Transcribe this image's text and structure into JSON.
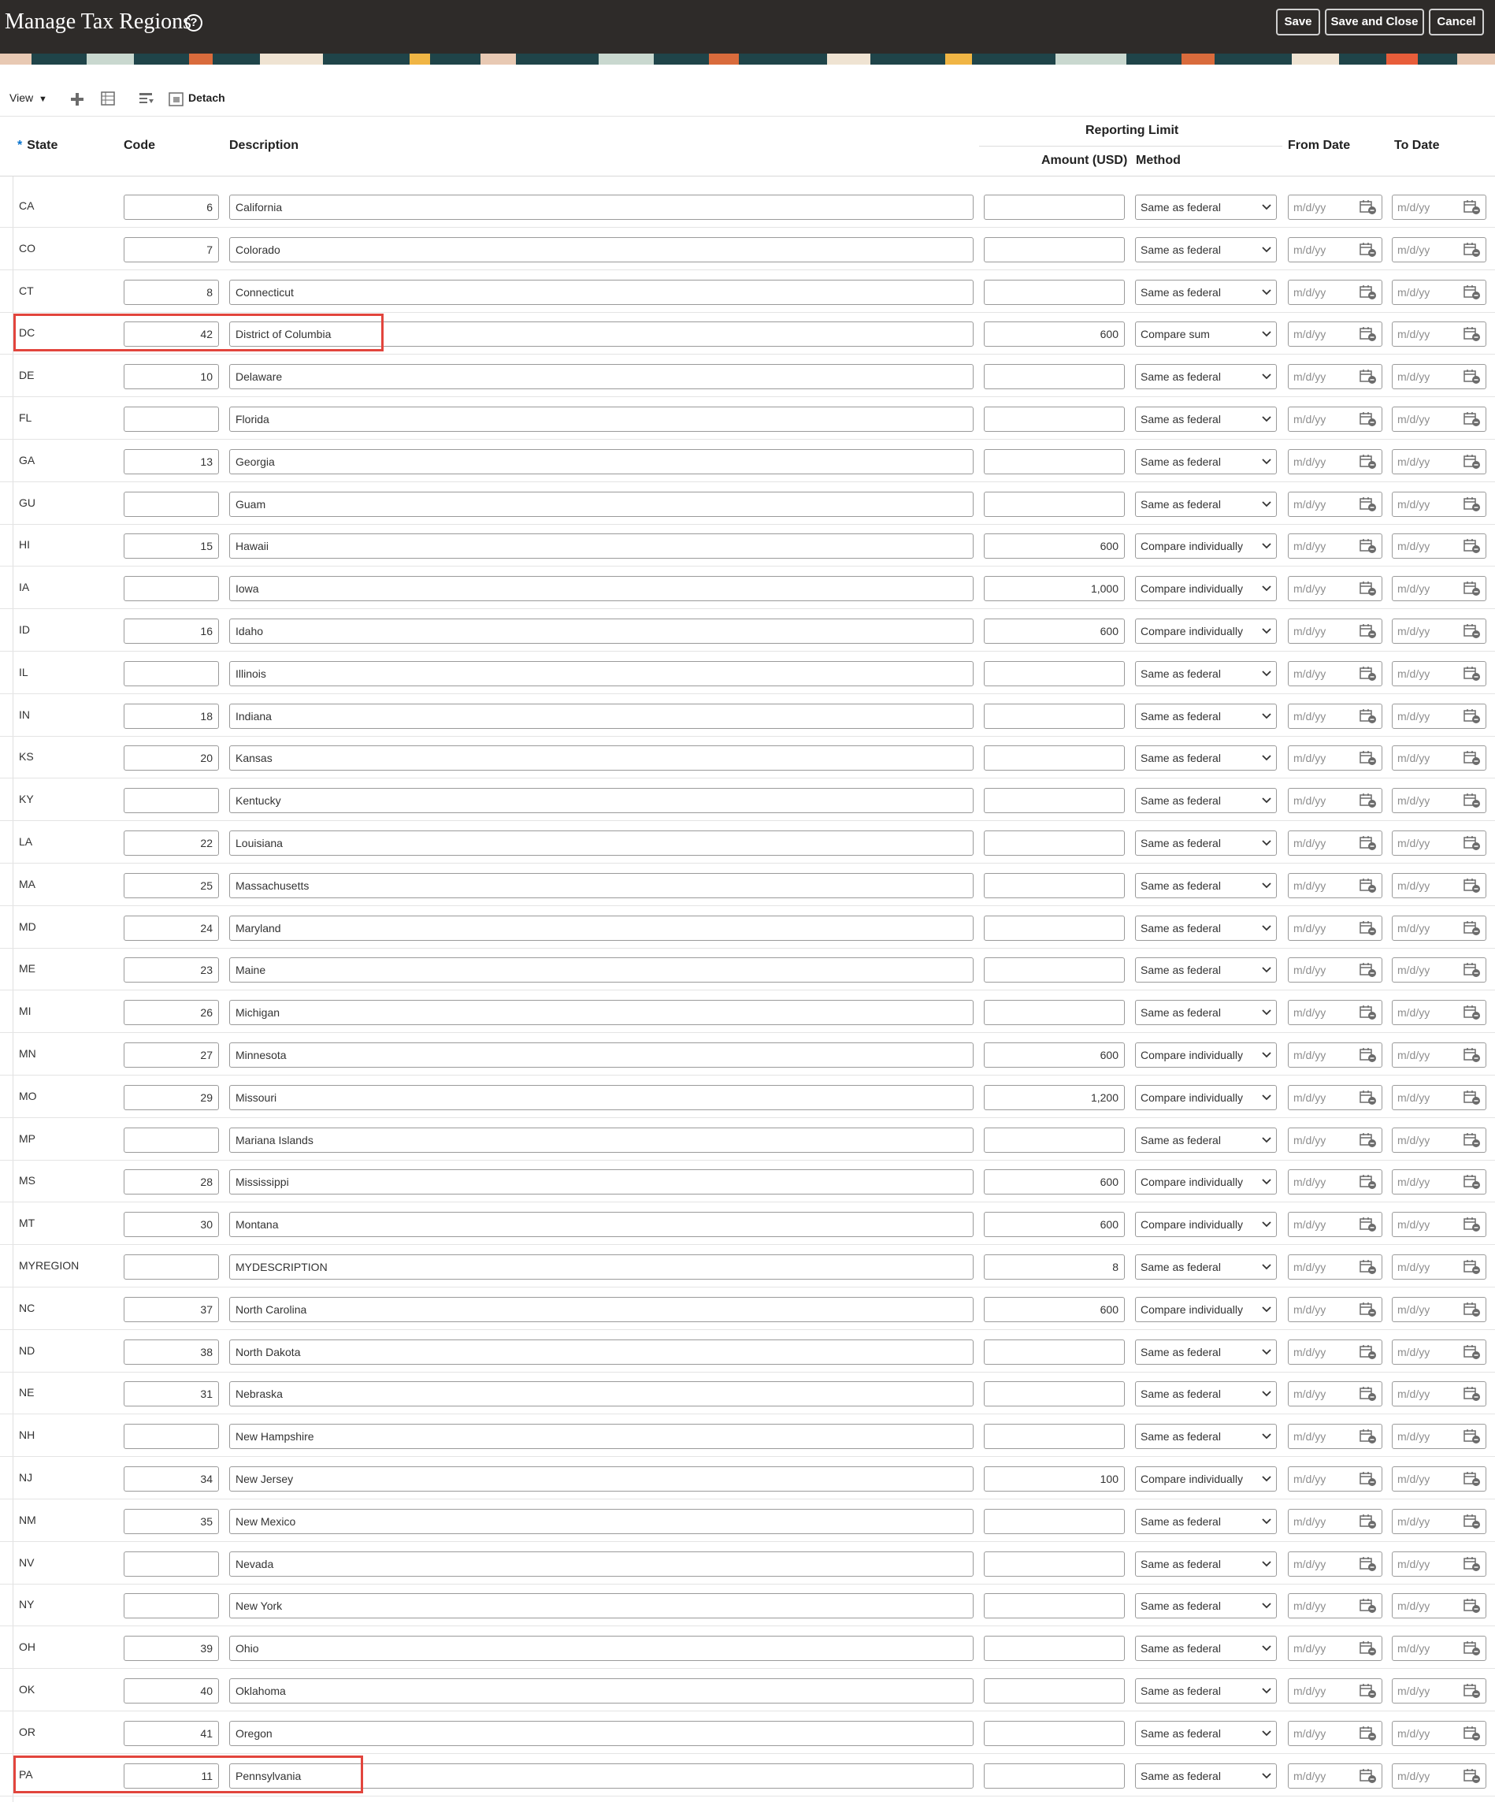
{
  "header": {
    "title": "Manage Tax Regions",
    "buttons": {
      "save": "Save",
      "save_close": "Save and Close",
      "cancel": "Cancel"
    }
  },
  "toolbar": {
    "view_label": "View",
    "detach_label": "Detach",
    "icons": [
      "add-icon",
      "freeze-icon",
      "wrap-icon",
      "detach-icon"
    ]
  },
  "columns": {
    "state": "State",
    "code": "Code",
    "description": "Description",
    "reporting_limit": "Reporting Limit",
    "amount": "Amount (USD)",
    "method": "Method",
    "from_date": "From Date",
    "to_date": "To Date"
  },
  "date_placeholder": "m/d/yy",
  "colors": {
    "header_bg": "#2e2b29",
    "highlight": "#e2453d",
    "required_star": "#0572ce"
  },
  "highlighted_rows": [
    "DC",
    "PA"
  ],
  "rows": [
    {
      "state": "CA",
      "code": "6",
      "description": "California",
      "amount": "",
      "method": "Same as federal"
    },
    {
      "state": "CO",
      "code": "7",
      "description": "Colorado",
      "amount": "",
      "method": "Same as federal"
    },
    {
      "state": "CT",
      "code": "8",
      "description": "Connecticut",
      "amount": "",
      "method": "Same as federal"
    },
    {
      "state": "DC",
      "code": "42",
      "description": "District of Columbia",
      "amount": "600",
      "method": "Compare sum"
    },
    {
      "state": "DE",
      "code": "10",
      "description": "Delaware",
      "amount": "",
      "method": "Same as federal"
    },
    {
      "state": "FL",
      "code": "",
      "description": "Florida",
      "amount": "",
      "method": "Same as federal"
    },
    {
      "state": "GA",
      "code": "13",
      "description": "Georgia",
      "amount": "",
      "method": "Same as federal"
    },
    {
      "state": "GU",
      "code": "",
      "description": "Guam",
      "amount": "",
      "method": "Same as federal"
    },
    {
      "state": "HI",
      "code": "15",
      "description": "Hawaii",
      "amount": "600",
      "method": "Compare individually"
    },
    {
      "state": "IA",
      "code": "",
      "description": "Iowa",
      "amount": "1,000",
      "method": "Compare individually"
    },
    {
      "state": "ID",
      "code": "16",
      "description": "Idaho",
      "amount": "600",
      "method": "Compare individually"
    },
    {
      "state": "IL",
      "code": "",
      "description": "Illinois",
      "amount": "",
      "method": "Same as federal"
    },
    {
      "state": "IN",
      "code": "18",
      "description": "Indiana",
      "amount": "",
      "method": "Same as federal"
    },
    {
      "state": "KS",
      "code": "20",
      "description": "Kansas",
      "amount": "",
      "method": "Same as federal"
    },
    {
      "state": "KY",
      "code": "",
      "description": "Kentucky",
      "amount": "",
      "method": "Same as federal"
    },
    {
      "state": "LA",
      "code": "22",
      "description": "Louisiana",
      "amount": "",
      "method": "Same as federal"
    },
    {
      "state": "MA",
      "code": "25",
      "description": "Massachusetts",
      "amount": "",
      "method": "Same as federal"
    },
    {
      "state": "MD",
      "code": "24",
      "description": "Maryland",
      "amount": "",
      "method": "Same as federal"
    },
    {
      "state": "ME",
      "code": "23",
      "description": "Maine",
      "amount": "",
      "method": "Same as federal"
    },
    {
      "state": "MI",
      "code": "26",
      "description": "Michigan",
      "amount": "",
      "method": "Same as federal"
    },
    {
      "state": "MN",
      "code": "27",
      "description": "Minnesota",
      "amount": "600",
      "method": "Compare individually"
    },
    {
      "state": "MO",
      "code": "29",
      "description": "Missouri",
      "amount": "1,200",
      "method": "Compare individually"
    },
    {
      "state": "MP",
      "code": "",
      "description": "Mariana Islands",
      "amount": "",
      "method": "Same as federal"
    },
    {
      "state": "MS",
      "code": "28",
      "description": "Mississippi",
      "amount": "600",
      "method": "Compare individually"
    },
    {
      "state": "MT",
      "code": "30",
      "description": "Montana",
      "amount": "600",
      "method": "Compare individually"
    },
    {
      "state": "MYREGION",
      "code": "",
      "description": "MYDESCRIPTION",
      "amount": "8",
      "method": "Same as federal"
    },
    {
      "state": "NC",
      "code": "37",
      "description": "North Carolina",
      "amount": "600",
      "method": "Compare individually"
    },
    {
      "state": "ND",
      "code": "38",
      "description": "North Dakota",
      "amount": "",
      "method": "Same as federal"
    },
    {
      "state": "NE",
      "code": "31",
      "description": "Nebraska",
      "amount": "",
      "method": "Same as federal"
    },
    {
      "state": "NH",
      "code": "",
      "description": "New Hampshire",
      "amount": "",
      "method": "Same as federal"
    },
    {
      "state": "NJ",
      "code": "34",
      "description": "New Jersey",
      "amount": "100",
      "method": "Compare individually"
    },
    {
      "state": "NM",
      "code": "35",
      "description": "New Mexico",
      "amount": "",
      "method": "Same as federal"
    },
    {
      "state": "NV",
      "code": "",
      "description": "Nevada",
      "amount": "",
      "method": "Same as federal"
    },
    {
      "state": "NY",
      "code": "",
      "description": "New York",
      "amount": "",
      "method": "Same as federal"
    },
    {
      "state": "OH",
      "code": "39",
      "description": "Ohio",
      "amount": "",
      "method": "Same as federal"
    },
    {
      "state": "OK",
      "code": "40",
      "description": "Oklahoma",
      "amount": "",
      "method": "Same as federal"
    },
    {
      "state": "OR",
      "code": "41",
      "description": "Oregon",
      "amount": "",
      "method": "Same as federal"
    },
    {
      "state": "PA",
      "code": "11",
      "description": "Pennsylvania",
      "amount": "",
      "method": "Same as federal"
    }
  ]
}
